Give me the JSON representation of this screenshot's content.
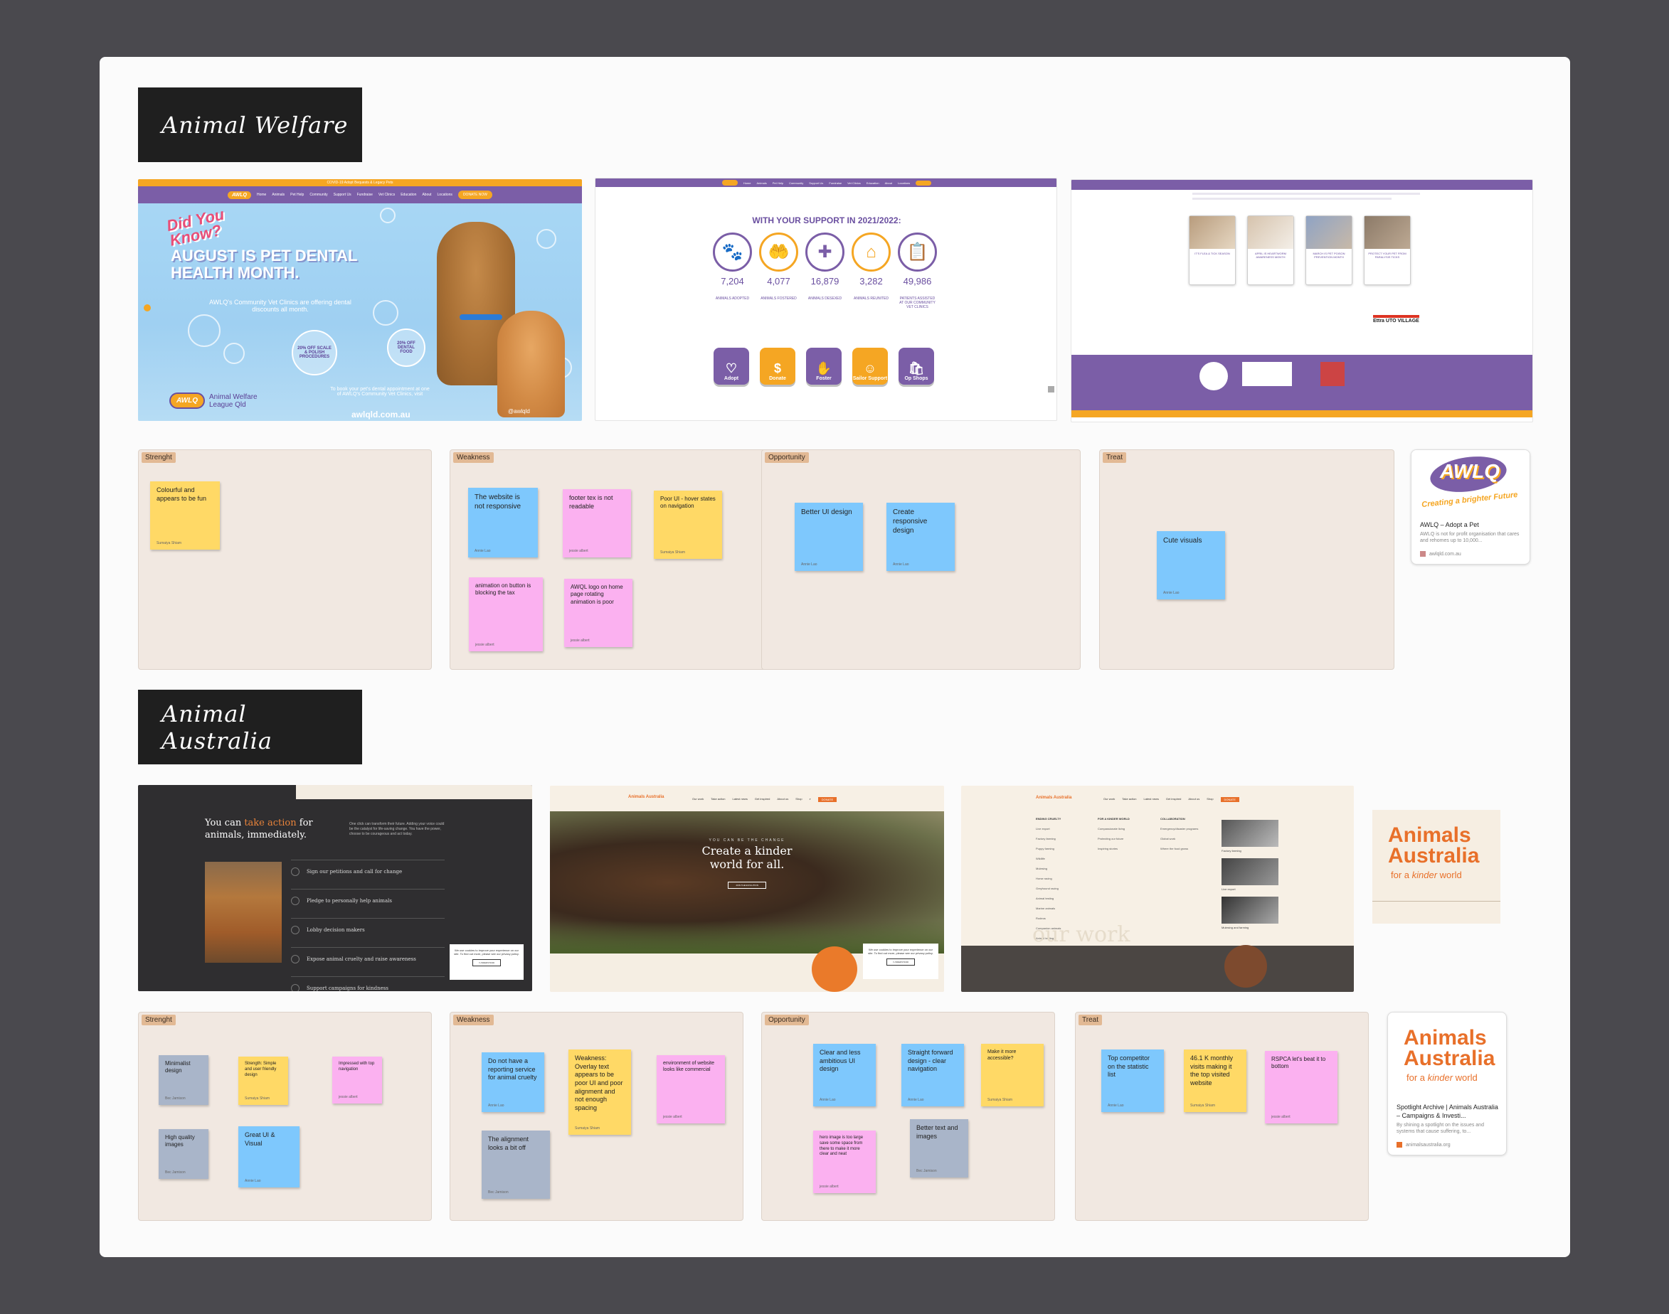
{
  "sections": [
    {
      "title": "Animal Welfare"
    },
    {
      "title": "Animal Australia"
    }
  ],
  "awlq_hero": {
    "topbar": "COVID-19 Adopt Bequests & Legacy Pets",
    "nav": [
      "Home",
      "Animals",
      "Pet Help",
      "Community",
      "Support Us",
      "Fundraise",
      "Vet Clinics",
      "Education",
      "About",
      "Locations"
    ],
    "cta": "DONATE NOW",
    "did_you_know": "Did You Know?",
    "headline": "AUGUST IS PET DENTAL HEALTH MONTH.",
    "sub": "AWLQ's Community Vet Clinics are offering dental discounts all month.",
    "offer1": "20% OFF SCALE & POLISH PROCEDURES",
    "offer2": "20% OFF DENTAL FOOD",
    "book": "To book your pet's dental appointment at one of AWLQ's Community Vet Clinics, visit",
    "url": "awlqld.com.au",
    "social": "@awlqld",
    "logo": "AWLQ",
    "org1": "Animal Welfare",
    "org2": "League Qld"
  },
  "awlq_stats": {
    "heading": "WITH YOUR SUPPORT IN 2021/2022:",
    "stats": [
      {
        "num": "7,204",
        "label": "ANIMALS ADOPTED",
        "icon": "🐾"
      },
      {
        "num": "4,077",
        "label": "ANIMALS FOSTERED",
        "icon": "🤲"
      },
      {
        "num": "16,879",
        "label": "ANIMALS DESEXED",
        "icon": "✚"
      },
      {
        "num": "3,282",
        "label": "ANIMALS REUNITED",
        "icon": "⌂"
      },
      {
        "num": "49,986",
        "label": "PATIENTS ASSISTED AT OUR COMMUNITY VET CLINICS",
        "icon": "📋"
      }
    ],
    "buttons": [
      "Adopt",
      "Donate",
      "Foster",
      "Sailor Support",
      "Op Shops"
    ]
  },
  "awlq_blog": {
    "cards": [
      "IT'S FLEA & TICK SEASON",
      "APRIL IS HEARTWORM AWARENESS MONTH",
      "MARCH IS PET POISON PREVENTION MONTH",
      "PROTECT YOUR PET FROM PARALYSIS TICKS"
    ],
    "sponsor": "Ettra UTO VILLAGE"
  },
  "swot_labels": [
    "Strenght",
    "Weakness",
    "Opportunity",
    "Treat"
  ],
  "welfare_notes": {
    "strength": [
      {
        "text": "Colourful and appears to be fun",
        "author": "Sumaiya Shiam"
      }
    ],
    "weakness": [
      {
        "text": "The website is not responsive",
        "author": "Annie Lao"
      },
      {
        "text": "footer tex is not readable",
        "author": "jessie albert"
      },
      {
        "text": "Poor UI - hover states on navigation",
        "author": "Sumaiya Shiam"
      },
      {
        "text": "animation on button is blocking the tax",
        "author": "jessie albert"
      },
      {
        "text": "AWQL logo on home page rotating animation is poor",
        "author": "jessie albert"
      }
    ],
    "opportunity": [
      {
        "text": "Better UI design",
        "author": "Annie Lao"
      },
      {
        "text": "Create responsive design",
        "author": "Annie Lao"
      }
    ],
    "treat": [
      {
        "text": "Cute visuals",
        "author": "Annie Lao"
      }
    ]
  },
  "awlq_card": {
    "logo": "AWLQ",
    "tagline": "Creating a brighter Future",
    "title": "AWLQ – Adopt a Pet",
    "desc": "AWLQ is not for profit organisation that cares and rehomes up to 10,000...",
    "url": "awlqld.com.au"
  },
  "aa_dark": {
    "headline_pre": "You can ",
    "headline_accent": "take action",
    "headline_post": " for animals, immediately.",
    "intro": "One click can transform their future. Adding your voice could be the catalyst for life-saving change. You have the power, choose to be courageous and act today.",
    "links": [
      "Sign our petitions and call for change",
      "Pledge to personally help animals",
      "Lobby decision makers",
      "Expose animal cruelty and raise awareness",
      "Support campaigns for kindness"
    ],
    "cookie": "We use cookies to improve your experience on our site. To find out more, please see our privacy policy.",
    "cookie_btn": "I UNDERSTAND"
  },
  "aa_hero": {
    "nav": [
      "Our work",
      "Take action",
      "Latest news",
      "Get inspired",
      "About us",
      "Shop"
    ],
    "donate": "DONATE",
    "kicker": "YOU CAN BE THE CHANGE",
    "headline": "Create a kinder world for all.",
    "cta": "JOIN THE EVOLUTION",
    "logo": "Animals Australia"
  },
  "aa_menu": {
    "col1_title": "ENDING CRUELTY",
    "col1": [
      "Live export",
      "Factory farming",
      "Puppy farming",
      "Wildlife",
      "Mulesing",
      "Horse racing",
      "Greyhound racing",
      "Animal testing",
      "Marine animals",
      "Rodeos",
      "Companion animals",
      "Animal testing",
      "Duck shooting",
      "Bats and reptiles"
    ],
    "col2_title": "FOR A KINDER WORLD",
    "col2": [
      "Compassionate living",
      "Protecting our future",
      "Inspiring stories"
    ],
    "col3_title": "COLLABORATION",
    "col3": [
      "Emergency/disaster programs",
      "Global work",
      "Where the food grows"
    ],
    "thumbs": [
      "Factory farming",
      "Live export",
      "Mulesing and farming"
    ],
    "bg_text": "our work"
  },
  "aa_logo": {
    "line1": "Animals",
    "line2": "Australia",
    "tag_pre": "for a ",
    "tag_em": "kinder",
    "tag_post": " world"
  },
  "aa_notes": {
    "strength": [
      {
        "text": "Minimalist design",
        "author": "Bec Jamison"
      },
      {
        "text": "Strength: Simple and user friendly design",
        "author": "Sumaiya Shiam"
      },
      {
        "text": "Impressed with top navigation",
        "author": "jessie albert"
      },
      {
        "text": "High quality images",
        "author": "Bec Jamison"
      },
      {
        "text": "Great UI & Visual",
        "author": "Annie Lao"
      }
    ],
    "weakness": [
      {
        "text": "Do not have a reporting service for animal cruelty",
        "author": "Annie Lao"
      },
      {
        "text": "Weakness: Overlay text appears to be poor UI and poor alignment and not enough spacing",
        "author": "Sumaiya Shiam"
      },
      {
        "text": "environment of website looks like commercial",
        "author": "jessie albert"
      },
      {
        "text": "The alignment looks a bit off",
        "author": "Bec Jamison"
      }
    ],
    "opportunity": [
      {
        "text": "Clear and less ambitious UI design",
        "author": "Annie Lao"
      },
      {
        "text": "Straight forward design - clear navigation",
        "author": "Annie Lao"
      },
      {
        "text": "Make it more accessible?",
        "author": "Sumaiya Shiam"
      },
      {
        "text": "hero image is too large save some space from there to make it more clear and neat",
        "author": "jessie albert"
      },
      {
        "text": "Better text and images",
        "author": "Bec Jamison"
      }
    ],
    "treat": [
      {
        "text": "Top competitor on the statistic list",
        "author": "Annie Lao"
      },
      {
        "text": "46.1 K monthly visits making it the top visited website",
        "author": "Sumaiya Shiam"
      },
      {
        "text": "RSPCA let's beat it to bottom",
        "author": "jessie albert"
      }
    ]
  },
  "aa_card": {
    "title": "Spotlight Archive | Animals Australia – Campaigns & Investi...",
    "desc": "By shining a spotlight on the issues and systems that cause suffering, to...",
    "url": "animalsaustralia.org"
  }
}
